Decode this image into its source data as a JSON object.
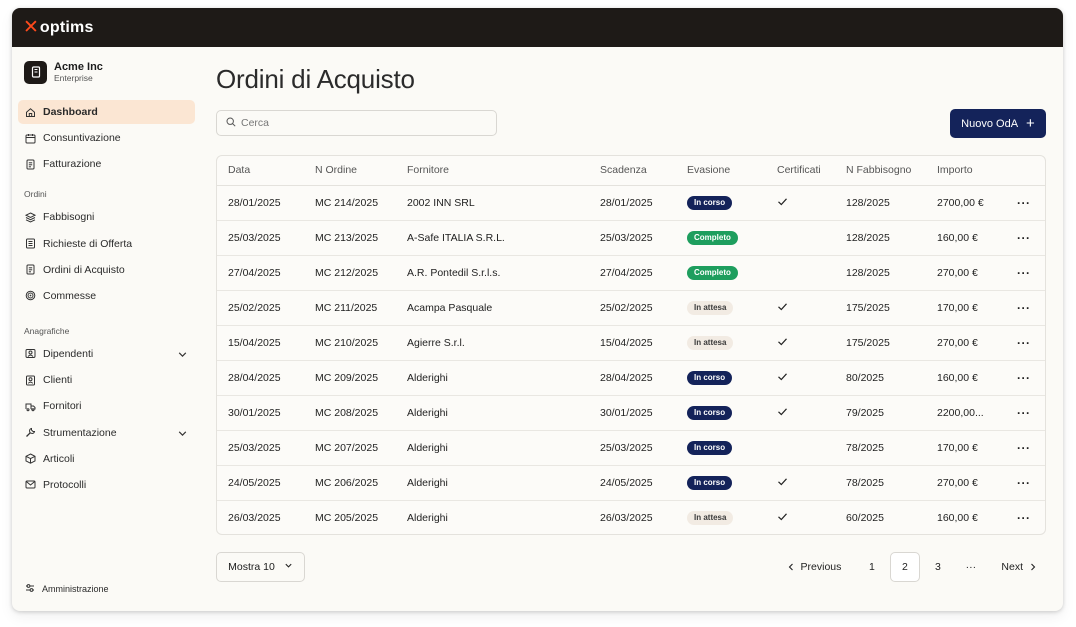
{
  "app": {
    "logo_mark": "✕",
    "logo_text": "optims"
  },
  "org": {
    "name": "Acme Inc",
    "plan": "Enterprise"
  },
  "nav_main": [
    {
      "label": "Dashboard",
      "icon": "home-icon",
      "active": true
    },
    {
      "label": "Consuntivazione",
      "icon": "calendar-icon"
    },
    {
      "label": "Fatturazione",
      "icon": "document-icon"
    }
  ],
  "section_ordini": "Ordini",
  "nav_ordini": [
    {
      "label": "Fabbisogni",
      "icon": "layers-icon"
    },
    {
      "label": "Richieste di Offerta",
      "icon": "list-icon"
    },
    {
      "label": "Ordini di Acquisto",
      "icon": "document-icon"
    },
    {
      "label": "Commesse",
      "icon": "target-icon"
    }
  ],
  "section_anagrafiche": "Anagrafiche",
  "nav_anagrafiche": [
    {
      "label": "Dipendenti",
      "icon": "users-icon",
      "expandable": true
    },
    {
      "label": "Clienti",
      "icon": "contact-icon"
    },
    {
      "label": "Fornitori",
      "icon": "truck-icon"
    },
    {
      "label": "Strumentazione",
      "icon": "wrench-icon",
      "expandable": true
    },
    {
      "label": "Articoli",
      "icon": "box-icon"
    },
    {
      "label": "Protocolli",
      "icon": "mail-icon"
    }
  ],
  "admin_label": "Amministrazione",
  "page": {
    "title": "Ordini di Acquisto",
    "search_placeholder": "Cerca",
    "new_button": "Nuovo OdA",
    "new_button_icon": "+"
  },
  "table": {
    "columns": [
      "Data",
      "N Ordine",
      "Fornitore",
      "Scadenza",
      "Evasione",
      "Certificati",
      "N Fabbisogno",
      "Importo",
      ""
    ],
    "rows": [
      {
        "data": "28/01/2025",
        "ordine": "MC 214/2025",
        "fornitore": "2002 INN SRL",
        "scadenza": "28/01/2025",
        "evasione": "In corso",
        "certificati": true,
        "fabbisogno": "128/2025",
        "importo": "2700,00 €"
      },
      {
        "data": "25/03/2025",
        "ordine": "MC 213/2025",
        "fornitore": "A-Safe ITALIA S.R.L.",
        "scadenza": "25/03/2025",
        "evasione": "Completo",
        "certificati": false,
        "fabbisogno": "128/2025",
        "importo": "160,00 €"
      },
      {
        "data": "27/04/2025",
        "ordine": "MC 212/2025",
        "fornitore": "A.R. Pontedil S.r.l.s.",
        "scadenza": "27/04/2025",
        "evasione": "Completo",
        "certificati": false,
        "fabbisogno": "128/2025",
        "importo": "270,00 €"
      },
      {
        "data": "25/02/2025",
        "ordine": "MC 211/2025",
        "fornitore": "Acampa Pasquale",
        "scadenza": "25/02/2025",
        "evasione": "In attesa",
        "certificati": true,
        "fabbisogno": "175/2025",
        "importo": "170,00 €"
      },
      {
        "data": "15/04/2025",
        "ordine": "MC 210/2025",
        "fornitore": "Agierre S.r.l.",
        "scadenza": "15/04/2025",
        "evasione": "In attesa",
        "certificati": true,
        "fabbisogno": "175/2025",
        "importo": "270,00 €"
      },
      {
        "data": "28/04/2025",
        "ordine": "MC 209/2025",
        "fornitore": "Alderighi",
        "scadenza": "28/04/2025",
        "evasione": "In corso",
        "certificati": true,
        "fabbisogno": "80/2025",
        "importo": "160,00 €"
      },
      {
        "data": "30/01/2025",
        "ordine": "MC 208/2025",
        "fornitore": "Alderighi",
        "scadenza": "30/01/2025",
        "evasione": "In corso",
        "certificati": true,
        "fabbisogno": "79/2025",
        "importo": "2200,00..."
      },
      {
        "data": "25/03/2025",
        "ordine": "MC 207/2025",
        "fornitore": "Alderighi",
        "scadenza": "25/03/2025",
        "evasione": "In corso",
        "certificati": false,
        "fabbisogno": "78/2025",
        "importo": "170,00 €"
      },
      {
        "data": "24/05/2025",
        "ordine": "MC 206/2025",
        "fornitore": "Alderighi",
        "scadenza": "24/05/2025",
        "evasione": "In corso",
        "certificati": true,
        "fabbisogno": "78/2025",
        "importo": "270,00 €"
      },
      {
        "data": "26/03/2025",
        "ordine": "MC 205/2025",
        "fornitore": "Alderighi",
        "scadenza": "26/03/2025",
        "evasione": "In attesa",
        "certificati": true,
        "fabbisogno": "60/2025",
        "importo": "160,00 €"
      }
    ],
    "row_action": "···"
  },
  "footer": {
    "show_label": "Mostra 10",
    "previous": "Previous",
    "pages": [
      "1",
      "2",
      "3"
    ],
    "current_page": "2",
    "ellipsis": "···",
    "next": "Next"
  },
  "colors": {
    "accent": "#14235a",
    "status_in_corso": "#14235a",
    "status_completo": "#1e9e5e",
    "status_in_attesa": "#f2ebe3",
    "active_nav": "#fbe6d3",
    "logo_mark": "#ff4a1c"
  }
}
